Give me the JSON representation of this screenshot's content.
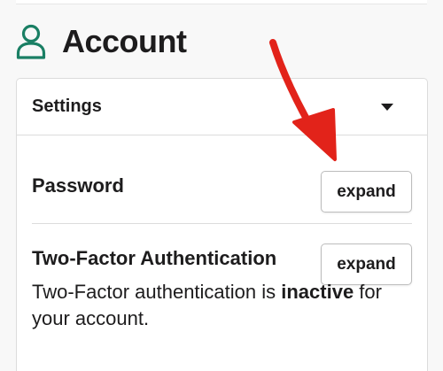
{
  "header": {
    "title": "Account",
    "icon": "user-icon",
    "icon_color": "#1a7f64"
  },
  "settings": {
    "label": "Settings",
    "caret_icon": "caret-down-icon"
  },
  "password": {
    "title": "Password",
    "button_label": "expand"
  },
  "two_factor": {
    "title": "Two-Factor Authentication",
    "button_label": "expand",
    "description_prefix": "Two-Factor authentication is ",
    "description_status": "inactive",
    "description_suffix": " for your account."
  },
  "annotation": {
    "icon": "red-arrow-icon",
    "color": "#e2231a"
  }
}
